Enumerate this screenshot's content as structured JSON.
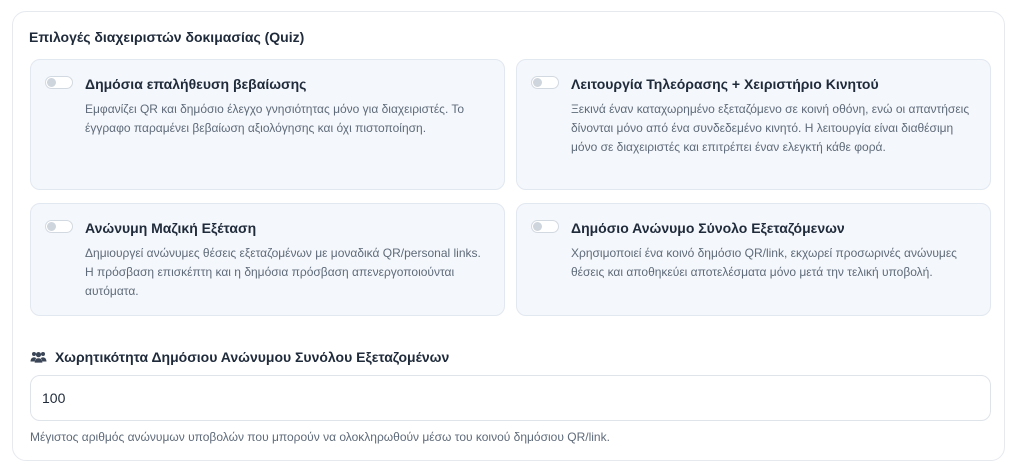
{
  "section": {
    "title": "Επιλογές διαχειριστών δοκιμασίας (Quiz)"
  },
  "options": [
    {
      "title": "Δημόσια επαλήθευση βεβαίωσης",
      "description": "Εμφανίζει QR και δημόσιο έλεγχο γνησιότητας μόνο για διαχειριστές. Το έγγραφο παραμένει βεβαίωση αξιολόγησης και όχι πιστοποίηση.",
      "enabled": false
    },
    {
      "title": "Λειτουργία Τηλεόρασης + Χειριστήριο Κινητού",
      "description": "Ξεκινά έναν καταχωρημένο εξεταζόμενο σε κοινή οθόνη, ενώ οι απαντήσεις δίνονται μόνο από ένα συνδεδεμένο κινητό. Η λειτουργία είναι διαθέσιμη μόνο σε διαχειριστές και επιτρέπει έναν ελεγκτή κάθε φορά.",
      "enabled": false
    },
    {
      "title": "Ανώνυμη Μαζική Εξέταση",
      "description": "Δημιουργεί ανώνυμες θέσεις εξεταζομένων με μοναδικά QR/personal links. Η πρόσβαση επισκέπτη και η δημόσια πρόσβαση απενεργοποιούνται αυτόματα.",
      "enabled": false
    },
    {
      "title": "Δημόσιο Ανώνυμο Σύνολο Εξεταζόμενων",
      "description": "Χρησιμοποιεί ένα κοινό δημόσιο QR/link, εκχωρεί προσωρινές ανώνυμες θέσεις και αποθηκεύει αποτελέσματα μόνο μετά την τελική υποβολή.",
      "enabled": false
    }
  ],
  "capacity": {
    "icon": "users-icon",
    "label": "Χωρητικότητα Δημόσιου Ανώνυμου Συνόλου Εξεταζομένων",
    "value": "100",
    "help": "Μέγιστος αριθμός ανώνυμων υποβολών που μπορούν να ολοκληρωθούν μέσω του κοινού δημόσιου QR/link."
  },
  "colors": {
    "card_background": "#f4f7fb",
    "card_border": "#e2e8f0",
    "text_primary": "#1f2a3a",
    "text_secondary": "#5f6b7a",
    "toggle_off": "#cfd5dd"
  }
}
